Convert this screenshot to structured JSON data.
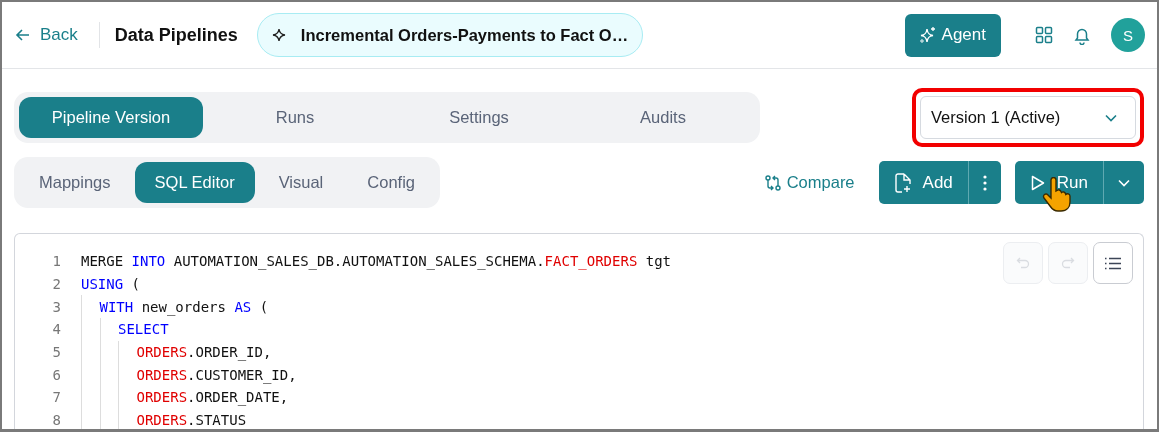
{
  "header": {
    "back": "Back",
    "title": "Data Pipelines",
    "pipeline_name": "Incremental Orders-Payments to Fact O…",
    "agent_button": "Agent",
    "avatar": "S"
  },
  "tabs": [
    {
      "label": "Pipeline Version",
      "selected": true
    },
    {
      "label": "Runs",
      "selected": false
    },
    {
      "label": "Settings",
      "selected": false
    },
    {
      "label": "Audits",
      "selected": false
    }
  ],
  "version_select": {
    "value": "Version 1 (Active)",
    "highlighted": true
  },
  "sub_tabs": [
    {
      "label": "Mappings",
      "selected": false
    },
    {
      "label": "SQL Editor",
      "selected": true
    },
    {
      "label": "Visual",
      "selected": false
    },
    {
      "label": "Config",
      "selected": false
    }
  ],
  "actions": {
    "compare": "Compare",
    "add": "Add",
    "run": "Run"
  },
  "editor_toolbar": [
    {
      "kind": "undo",
      "disabled": true
    },
    {
      "kind": "redo",
      "disabled": true
    },
    {
      "kind": "outline",
      "disabled": false
    }
  ],
  "code": [
    {
      "number": "1",
      "tokens": [
        {
          "kind": "plain",
          "text": "MERGE "
        },
        {
          "kind": "keyword",
          "text": "INTO"
        },
        {
          "kind": "plain",
          "text": " AUTOMATION_SALES_DB.AUTOMATION_SALES_SCHEMA."
        },
        {
          "kind": "table",
          "text": "FACT_ORDERS"
        },
        {
          "kind": "plain",
          "text": " tgt"
        }
      ]
    },
    {
      "number": "2",
      "tokens": [
        {
          "kind": "keyword",
          "text": "USING"
        },
        {
          "kind": "plain",
          "text": " ("
        }
      ],
      "children": [
        {
          "number": "3",
          "tokens": [
            {
              "kind": "keyword",
              "text": "WITH"
            },
            {
              "kind": "plain",
              "text": " new_orders "
            },
            {
              "kind": "keyword",
              "text": "AS"
            },
            {
              "kind": "plain",
              "text": " ("
            }
          ],
          "children": [
            {
              "number": "4",
              "tokens": [
                {
                  "kind": "keyword",
                  "text": "SELECT"
                }
              ],
              "children": [
                {
                  "number": "5",
                  "tokens": [
                    {
                      "kind": "table",
                      "text": "ORDERS"
                    },
                    {
                      "kind": "plain",
                      "text": ".ORDER_ID,"
                    }
                  ]
                },
                {
                  "number": "6",
                  "tokens": [
                    {
                      "kind": "table",
                      "text": "ORDERS"
                    },
                    {
                      "kind": "plain",
                      "text": ".CUSTOMER_ID,"
                    }
                  ]
                },
                {
                  "number": "7",
                  "tokens": [
                    {
                      "kind": "table",
                      "text": "ORDERS"
                    },
                    {
                      "kind": "plain",
                      "text": ".ORDER_DATE,"
                    }
                  ]
                },
                {
                  "number": "8",
                  "tokens": [
                    {
                      "kind": "table",
                      "text": "ORDERS"
                    },
                    {
                      "kind": "plain",
                      "text": ".STATUS"
                    }
                  ]
                }
              ]
            }
          ]
        }
      ]
    }
  ]
}
